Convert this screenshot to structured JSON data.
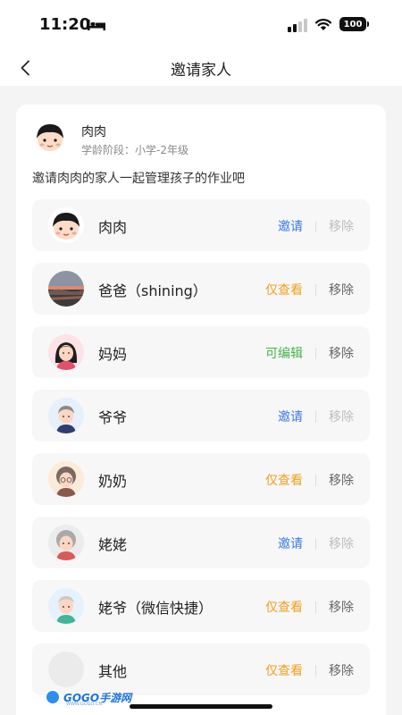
{
  "status_bar": {
    "time": "11:20",
    "battery": "100"
  },
  "header": {
    "title": "邀请家人"
  },
  "child": {
    "name": "肉肉",
    "stage": "学龄阶段：小学-2年级"
  },
  "invite_tip": "邀请肉肉的家人一起管理孩子的作业吧",
  "members": [
    {
      "name": "肉肉",
      "status": "邀请",
      "remove": "移除"
    },
    {
      "name": "爸爸（shining）",
      "status": "仅查看",
      "remove": "移除"
    },
    {
      "name": "妈妈",
      "status": "可编辑",
      "remove": "移除"
    },
    {
      "name": "爷爷",
      "status": "邀请",
      "remove": "移除"
    },
    {
      "name": "奶奶",
      "status": "仅查看",
      "remove": "移除"
    },
    {
      "name": "姥姥",
      "status": "邀请",
      "remove": "移除"
    },
    {
      "name": "姥爷（微信快捷）",
      "status": "仅查看",
      "remove": "移除"
    },
    {
      "name": "其他",
      "status": "仅查看",
      "remove": "移除"
    }
  ],
  "colors": {
    "invite": "#3b78e7",
    "view_only": "#f0a020",
    "editable": "#43b44b"
  },
  "watermark": {
    "logo": "GOGO手游网",
    "sub": "WWW.GOGO.CN"
  }
}
